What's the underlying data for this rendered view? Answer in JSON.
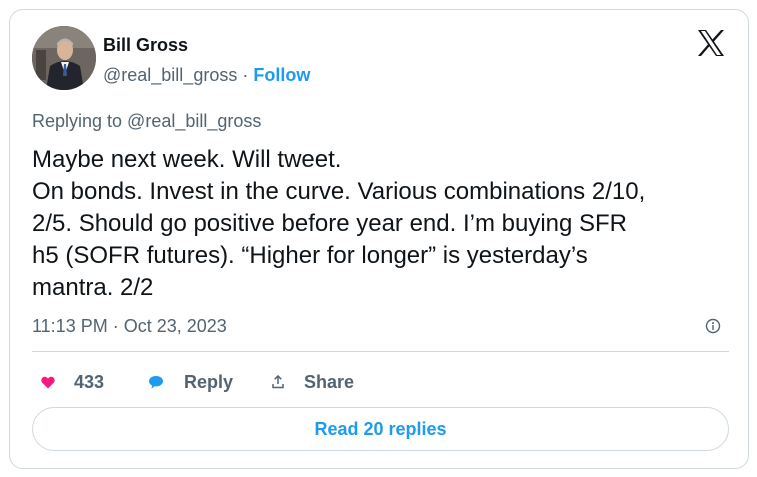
{
  "author": {
    "name": "Bill Gross",
    "handle": "@real_bill_gross",
    "separator": " · ",
    "follow_label": "Follow"
  },
  "icons": {
    "brand": "x-logo-icon",
    "info": "info-icon",
    "like": "heart-icon",
    "reply": "speech-bubble-icon",
    "share": "share-upload-icon"
  },
  "tweet": {
    "replying_to": "Replying to @real_bill_gross",
    "lines": [
      "Maybe next week. Will tweet.",
      "On bonds. Invest in the curve. Various combinations 2/10,",
      "2/5. Should go positive before year end. I’m buying SFR",
      "h5 (SOFR futures). “Higher for longer” is yesterday’s",
      "mantra. 2/2"
    ],
    "timestamp": "11:13 PM · Oct 23, 2023"
  },
  "actions": {
    "like_count": "433",
    "reply_label": "Reply",
    "share_label": "Share"
  },
  "read_replies_label": "Read 20 replies",
  "colors": {
    "accent": "#1d9bf0",
    "heart": "#f91880",
    "text_primary": "#0f1419",
    "text_secondary": "#536471",
    "border": "#cfd9de"
  }
}
